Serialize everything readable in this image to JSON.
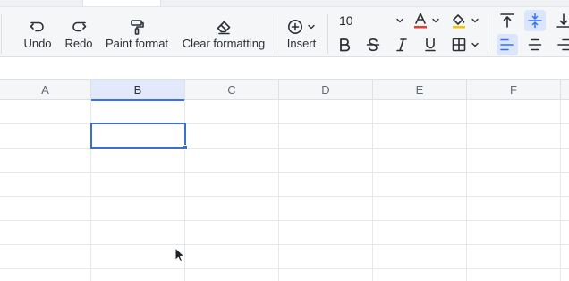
{
  "toolbar": {
    "undo_label": "Undo",
    "redo_label": "Redo",
    "paint_format_label": "Paint format",
    "clear_formatting_label": "Clear formatting",
    "insert_label": "Insert",
    "font_size": "10"
  },
  "columns": [
    "A",
    "B",
    "C",
    "D",
    "E",
    "F"
  ],
  "selection": {
    "column": "B"
  },
  "colors": {
    "accent": "#3370ff",
    "font_color_bar": "#e8392c",
    "fill_color_bar": "#f5c400"
  }
}
